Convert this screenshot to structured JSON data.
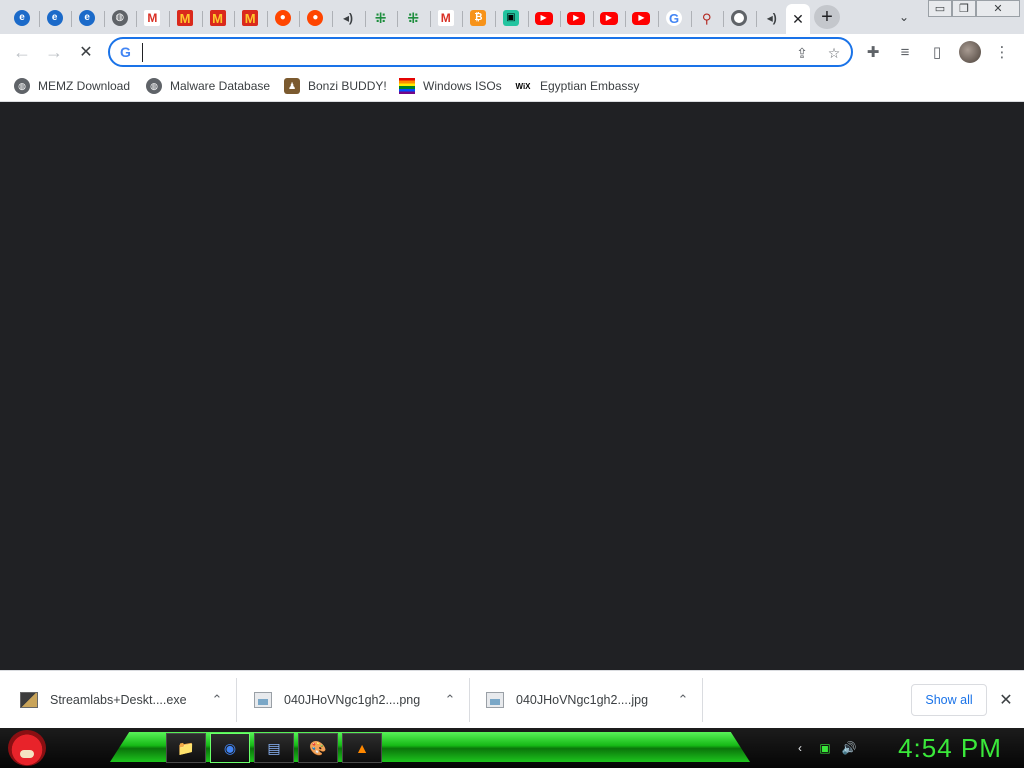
{
  "tabs": [
    {
      "icon": "internet-explorer-icon",
      "glyph": "e",
      "cls": "fav-ie"
    },
    {
      "icon": "internet-explorer-icon",
      "glyph": "e",
      "cls": "fav-ie"
    },
    {
      "icon": "internet-explorer-icon",
      "glyph": "e",
      "cls": "fav-ie"
    },
    {
      "icon": "globe-icon",
      "glyph": "◍",
      "cls": "fav-globe"
    },
    {
      "icon": "gmail-icon",
      "glyph": "M",
      "cls": "fav-gmail"
    },
    {
      "icon": "mcdonalds-icon",
      "glyph": "M",
      "cls": "fav-mcd"
    },
    {
      "icon": "mcdonalds-icon",
      "glyph": "M",
      "cls": "fav-mcd"
    },
    {
      "icon": "mcdonalds-icon",
      "glyph": "M",
      "cls": "fav-mcd"
    },
    {
      "icon": "reddit-icon",
      "glyph": "●",
      "cls": "fav-reddit"
    },
    {
      "icon": "reddit-icon",
      "glyph": "●",
      "cls": "fav-reddit"
    },
    {
      "icon": "speaker-icon",
      "glyph": "◂)",
      "cls": "fav-sound"
    },
    {
      "icon": "grid-logo-icon",
      "glyph": "⁜",
      "cls": "fav-grid"
    },
    {
      "icon": "grid-logo-icon",
      "glyph": "⁜",
      "cls": "fav-grid"
    },
    {
      "icon": "gmail-icon",
      "glyph": "M",
      "cls": "fav-gmail"
    },
    {
      "icon": "bitcoin-icon",
      "glyph": "₿",
      "cls": "fav-bitcoin"
    },
    {
      "icon": "chat-bot-icon",
      "glyph": "▣",
      "cls": "fav-teal"
    },
    {
      "icon": "youtube-icon",
      "glyph": "▶",
      "cls": "fav-yt"
    },
    {
      "icon": "youtube-icon",
      "glyph": "▶",
      "cls": "fav-yt"
    },
    {
      "icon": "youtube-icon",
      "glyph": "▶",
      "cls": "fav-yt"
    },
    {
      "icon": "youtube-icon",
      "glyph": "▶",
      "cls": "fav-yt"
    },
    {
      "icon": "google-icon",
      "glyph": "G",
      "cls": "fav-google"
    },
    {
      "icon": "pin-icon",
      "glyph": "⚲",
      "cls": "fav-pin"
    },
    {
      "icon": "chrome-icon",
      "glyph": "",
      "cls": "fav-chrome"
    },
    {
      "icon": "speaker-icon",
      "glyph": "◂)",
      "cls": "fav-sound"
    }
  ],
  "active_tab": {
    "close_glyph": "✕"
  },
  "new_tab": {
    "glyph": "+"
  },
  "tab_search": {
    "glyph": "⌄"
  },
  "window_controls": {
    "minimize": "▭",
    "restore": "❐",
    "close": "✕"
  },
  "toolbar": {
    "back_glyph": "←",
    "forward_glyph": "→",
    "reload_glyph": "✕",
    "omnibox_value": "",
    "omnibox_placeholder": "",
    "google_glyph": "G",
    "share_glyph": "⇪",
    "star_glyph": "☆",
    "extensions_glyph": "✚",
    "media_glyph": "≡",
    "sidepanel_glyph": "▯",
    "menu_glyph": "⋮"
  },
  "bookmarks": [
    {
      "label": "MEMZ Download",
      "icon": "globe-icon",
      "glyph": "◍"
    },
    {
      "label": "Malware Database",
      "icon": "globe-icon",
      "glyph": "◍"
    },
    {
      "label": "Bonzi BUDDY!",
      "icon": "bonzi-icon",
      "glyph": "♟"
    },
    {
      "label": "Windows ISOs",
      "icon": "rainbow-flag-icon",
      "glyph": ""
    },
    {
      "label": "Egyptian Embassy",
      "icon": "wix-icon",
      "glyph": "WiX"
    }
  ],
  "downloads": [
    {
      "filename": "Streamlabs+Deskt....exe",
      "type": "exe"
    },
    {
      "filename": "040JHoVNgc1gh2....png",
      "type": "png"
    },
    {
      "filename": "040JHoVNgc1gh2....jpg",
      "type": "jpg"
    }
  ],
  "downloads_shelf": {
    "show_all": "Show all",
    "close_glyph": "✕",
    "arrow_glyph": "⌃"
  },
  "taskbar": {
    "apps": [
      {
        "icon": "file-explorer-icon",
        "glyph": "📁"
      },
      {
        "icon": "chrome-icon",
        "glyph": "◉"
      },
      {
        "icon": "notepad-icon",
        "glyph": "▤"
      },
      {
        "icon": "paint-icon",
        "glyph": "🎨"
      },
      {
        "icon": "vlc-icon",
        "glyph": "▲"
      }
    ],
    "tray": {
      "back_glyph": "‹",
      "network_glyph": "▣",
      "volume_glyph": "🔊"
    },
    "clock": "4:54 PM"
  },
  "colors": {
    "accent": "#1a73e8",
    "content_bg": "#202124",
    "clock": "#3ae83a",
    "taskbar_green": "#16c216"
  }
}
